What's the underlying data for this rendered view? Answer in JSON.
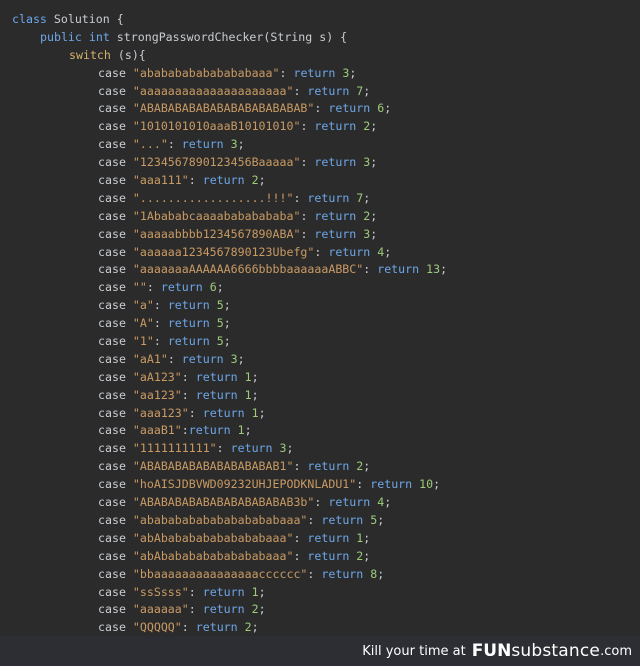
{
  "code": {
    "class_line": {
      "kw": "class",
      "rest": " Solution {"
    },
    "method_line": {
      "kw1": "public",
      "kw2": "int",
      "rest": " strongPasswordChecker(String s) {"
    },
    "switch_line": {
      "kw": "switch",
      "rest": " (s){"
    },
    "cases": [
      {
        "str": "\"ababababababababaaa\"",
        "ret": "3"
      },
      {
        "str": "\"aaaaaaaaaaaaaaaaaaaaa\"",
        "ret": "7"
      },
      {
        "str": "\"ABABABABABABABABABABABAB\"",
        "ret": "6"
      },
      {
        "str": "\"1010101010aaaB10101010\"",
        "ret": "2"
      },
      {
        "str": "\"...\"",
        "ret": "3"
      },
      {
        "str": "\"1234567890123456Baaaaa\"",
        "ret": "3"
      },
      {
        "str": "\"aaa111\"",
        "ret": "2"
      },
      {
        "str": "\"..................!!!\"",
        "ret": "7"
      },
      {
        "str": "\"1Ababab​caaaabababababa\"",
        "ret": "2"
      },
      {
        "str": "\"aaaaabbbb1234567890ABA\"",
        "ret": "3"
      },
      {
        "str": "\"aaaaaa1234567890123Ubefg\"",
        "ret": "4"
      },
      {
        "str": "\"aaaaaaaAAAAAA6666bbbbaaaaaaABBC\"",
        "ret": "13"
      },
      {
        "str": "\"\"",
        "ret": "6"
      },
      {
        "str": "\"a\"",
        "ret": "5"
      },
      {
        "str": "\"A\"",
        "ret": "5"
      },
      {
        "str": "\"1\"",
        "ret": "5"
      },
      {
        "str": "\"aA1\"",
        "ret": "3"
      },
      {
        "str": "\"aA123\"",
        "ret": "1"
      },
      {
        "str": "\"aa123\"",
        "ret": "1"
      },
      {
        "str": "\"aaa123\"",
        "ret": "1"
      },
      {
        "str": "\"aaaB1\"",
        "ret": "1",
        "nospace": true
      },
      {
        "str": "\"1111111111\"",
        "ret": "3"
      },
      {
        "str": "\"ABABABABABABABABABAB1\"",
        "ret": "2"
      },
      {
        "str": "\"hoAISJDBVWD09232UHJEPODKNLADU1\"",
        "ret": "10"
      },
      {
        "str": "\"ABABABABABABABABABABAB3b\"",
        "ret": "4"
      },
      {
        "str": "\"ababababababababababaaa\"",
        "ret": "5"
      },
      {
        "str": "\"abAbabababababababaaa\"",
        "ret": "1"
      },
      {
        "str": "\"abAbabababababababaaa\"",
        "ret": "2"
      },
      {
        "str": "\"bbaaaaaaaaaaaaaaacccccc\"",
        "ret": "8"
      },
      {
        "str": "\"ssSsss\"",
        "ret": "1"
      },
      {
        "str": "\"aaaaaa\"",
        "ret": "2"
      },
      {
        "str": "\"QQQQQ\"",
        "ret": "2"
      }
    ],
    "case_kw": "case",
    "return_kw": "return"
  },
  "footer": {
    "tagline": "Kill your time at",
    "brand_bold": "FUN",
    "brand_rest": "substance",
    "brand_tld": ".com"
  }
}
